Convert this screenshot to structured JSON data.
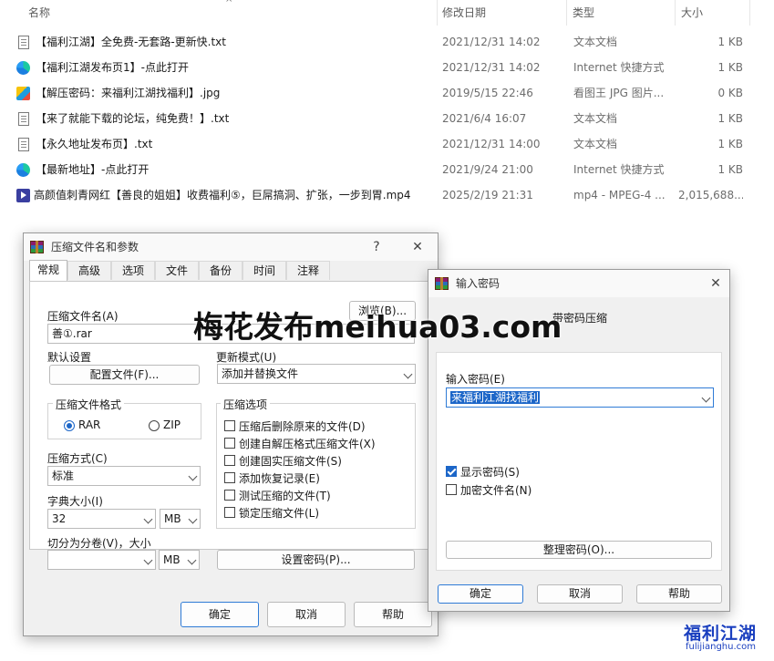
{
  "explorer": {
    "columns": {
      "name": "名称",
      "date": "修改日期",
      "type": "类型",
      "size": "大小"
    },
    "files": [
      {
        "icon": "text-file-icon",
        "name": "【福利江湖】全免费-无套路-更新快.txt",
        "date": "2021/12/31 14:02",
        "type": "文本文档",
        "size": "1 KB"
      },
      {
        "icon": "internet-shortcut-icon",
        "name": "【福利江湖发布页1】-点此打开",
        "date": "2021/12/31 14:02",
        "type": "Internet 快捷方式",
        "size": "1 KB"
      },
      {
        "icon": "image-file-icon",
        "name": "【解压密码：来福利江湖找福利】.jpg",
        "date": "2019/5/15 22:46",
        "type": "看图王 JPG 图片...",
        "size": "0 KB"
      },
      {
        "icon": "text-file-icon",
        "name": "【来了就能下载的论坛，纯免费！】.txt",
        "date": "2021/6/4 16:07",
        "type": "文本文档",
        "size": "1 KB"
      },
      {
        "icon": "text-file-icon",
        "name": "【永久地址发布页】.txt",
        "date": "2021/12/31 14:00",
        "type": "文本文档",
        "size": "1 KB"
      },
      {
        "icon": "internet-shortcut-icon",
        "name": "【最新地址】-点此打开",
        "date": "2021/9/24 21:00",
        "type": "Internet 快捷方式",
        "size": "1 KB"
      },
      {
        "icon": "video-file-icon",
        "name": "高颜值刺青网红【善良的姐姐】收费福利⑤，巨屌搞洞、扩张，一步到胃.mp4",
        "date": "2025/2/19 21:31",
        "type": "mp4 - MPEG-4 ...",
        "size": "2,015,688..."
      }
    ]
  },
  "archive_dialog": {
    "title": "压缩文件名和参数",
    "help_symbol": "?",
    "close_symbol": "✕",
    "tabs": [
      "常规",
      "高级",
      "选项",
      "文件",
      "备份",
      "时间",
      "注释"
    ],
    "archive_name_label": "压缩文件名(A)",
    "archive_name_value": "善①.rar",
    "browse_label": "浏览(B)...",
    "default_settings_label": "默认设置",
    "profiles_label": "配置文件(F)...",
    "update_mode_label": "更新模式(U)",
    "update_mode_value": "添加并替换文件",
    "format_group_title": "压缩文件格式",
    "format_rar": "RAR",
    "format_zip": "ZIP",
    "options_group_title": "压缩选项",
    "options": [
      {
        "label": "压缩后删除原来的文件(D)",
        "checked": false
      },
      {
        "label": "创建自解压格式压缩文件(X)",
        "checked": false
      },
      {
        "label": "创建固实压缩文件(S)",
        "checked": false
      },
      {
        "label": "添加恢复记录(E)",
        "checked": false
      },
      {
        "label": "测试压缩的文件(T)",
        "checked": false
      },
      {
        "label": "锁定压缩文件(L)",
        "checked": false
      }
    ],
    "method_label": "压缩方式(C)",
    "method_value": "标准",
    "dict_label": "字典大小(I)",
    "dict_value": "32",
    "dict_unit": "MB",
    "split_label": "切分为分卷(V)，大小",
    "split_value": "",
    "split_unit": "MB",
    "set_password_label": "设置密码(P)...",
    "ok_label": "确定",
    "cancel_label": "取消",
    "help_label": "帮助"
  },
  "password_dialog": {
    "title": "输入密码",
    "close_symbol": "✕",
    "subtitle": "带密码压缩",
    "enter_label": "输入密码(E)",
    "password_value": "来福利江湖找福利",
    "show_password_label": "显示密码(S)",
    "show_password_checked": true,
    "encrypt_names_label": "加密文件名(N)",
    "encrypt_names_checked": false,
    "organize_label": "整理密码(O)...",
    "ok_label": "确定",
    "cancel_label": "取消",
    "help_label": "帮助"
  },
  "watermarks": {
    "center": "梅花发布meihua03.com",
    "corner_logo": "福利江湖",
    "corner_url": "fulijianghu.com"
  },
  "colors": {
    "accent": "#1c66c8",
    "watermark_logo": "#1a3fbf",
    "watermark_logo_red": "#d92b2b"
  }
}
